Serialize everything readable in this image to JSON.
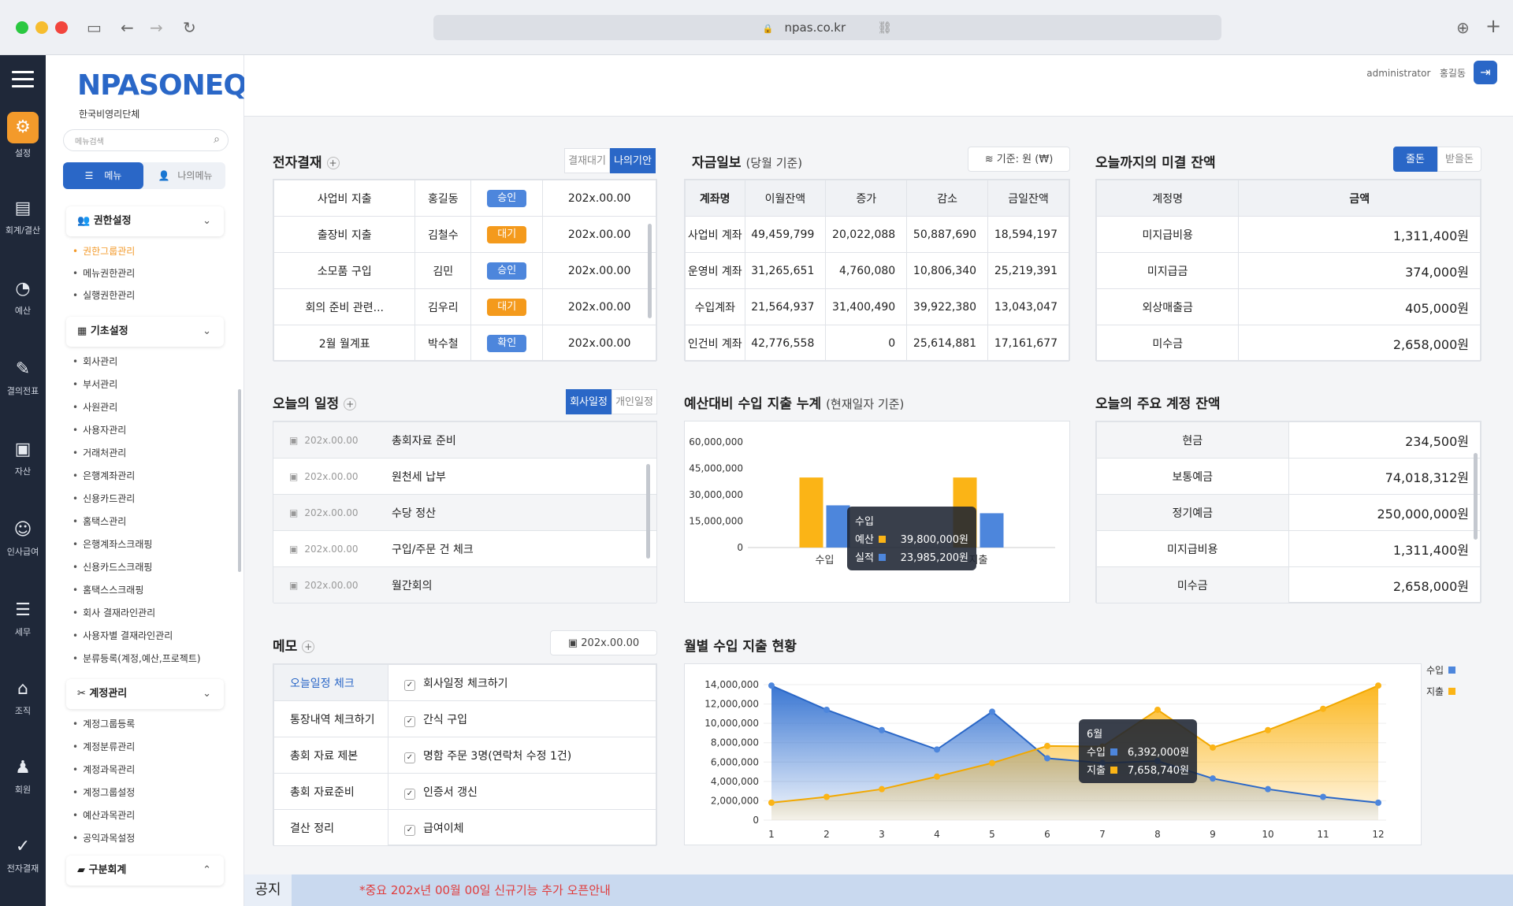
{
  "browser": {
    "url": "npas.co.kr"
  },
  "colors": {
    "accent": "#2a67c7",
    "orange": "#f49a1c",
    "income": "#4d86dc",
    "expense": "#fbb416",
    "notice": "#e03c3c"
  },
  "rail": [
    {
      "label": "설정",
      "icon": "gear-icon"
    },
    {
      "label": "회계/결산",
      "icon": "ledger-icon"
    },
    {
      "label": "예산",
      "icon": "pie-icon"
    },
    {
      "label": "결의전표",
      "icon": "voucher-icon"
    },
    {
      "label": "자산",
      "icon": "asset-icon"
    },
    {
      "label": "인사급여",
      "icon": "person-salary-icon"
    },
    {
      "label": "세무",
      "icon": "tax-icon"
    },
    {
      "label": "조직",
      "icon": "org-icon"
    },
    {
      "label": "회원",
      "icon": "members-icon"
    },
    {
      "label": "전자결재",
      "icon": "approval-icon"
    }
  ],
  "sidebar": {
    "logo": "NPASONEQ",
    "org": "한국비영리단체",
    "search_placeholder": "메뉴검색",
    "tab_menu": "메뉴",
    "tab_my": "나의메뉴",
    "group1": {
      "label": "권한설정",
      "items": [
        "권한그룹관리",
        "메뉴권한관리",
        "실행권한관리"
      ]
    },
    "group2": {
      "label": "기초설정",
      "items": [
        "회사관리",
        "부서관리",
        "사원관리",
        "사용자관리",
        "거래처관리",
        "은행계좌관리",
        "신용카드관리",
        "홈택스관리",
        "은행계좌스크래핑",
        "신용카드스크래핑",
        "홈택스스크래핑",
        "회사 결재라인관리",
        "사용자별 결재라인관리",
        "분류등록(계정,예산,프로젝트)"
      ]
    },
    "group3": {
      "label": "계정관리",
      "items": [
        "계정그룹등록",
        "계정분류관리",
        "계정과목관리",
        "계정그룹설정",
        "예산과목관리",
        "공익과목설정"
      ]
    },
    "group4": {
      "label": "구분회계"
    }
  },
  "header": {
    "user": "administrator",
    "name": "홍길동"
  },
  "approval": {
    "title": "전자결재",
    "tab_wait": "결재대기",
    "tab_mine": "나의기안",
    "rows": [
      {
        "title": "사업비 지출",
        "user": "홍길동",
        "status": "승인",
        "date": "202x.00.00"
      },
      {
        "title": "출장비 지출",
        "user": "김철수",
        "status": "대기",
        "date": "202x.00.00"
      },
      {
        "title": "소모품 구입",
        "user": "김민",
        "status": "승인",
        "date": "202x.00.00"
      },
      {
        "title": "회의 준비 관련...",
        "user": "김우리",
        "status": "대기",
        "date": "202x.00.00"
      },
      {
        "title": "2월 월계표",
        "user": "박수철",
        "status": "확인",
        "date": "202x.00.00"
      }
    ]
  },
  "funds": {
    "title": "자금일보",
    "subtitle": "(당월 기준)",
    "basis": "기준: 원 (₩)",
    "headers": [
      "계좌명",
      "이월잔액",
      "증가",
      "감소",
      "금일잔액"
    ],
    "rows": [
      [
        "사업비 계좌",
        "49,459,799",
        "20,022,088",
        "50,887,690",
        "18,594,197"
      ],
      [
        "운영비 계좌",
        "31,265,651",
        "4,760,080",
        "10,806,340",
        "25,219,391"
      ],
      [
        "수입계좌",
        "21,564,937",
        "31,400,490",
        "39,922,380",
        "13,043,047"
      ],
      [
        "인건비 계좌",
        "42,776,558",
        "0",
        "25,614,881",
        "17,161,677"
      ]
    ]
  },
  "unsettled": {
    "title": "오늘까지의 미결 잔액",
    "tab_give": "줄돈",
    "tab_recv": "받을돈",
    "headers": [
      "계정명",
      "금액"
    ],
    "rows": [
      [
        "미지급비용",
        "1,311,400원"
      ],
      [
        "미지급금",
        "374,000원"
      ],
      [
        "외상매출금",
        "405,000원"
      ],
      [
        "미수금",
        "2,658,000원"
      ]
    ]
  },
  "schedule": {
    "title": "오늘의 일정",
    "tab_company": "회사일정",
    "tab_personal": "개인일정",
    "rows": [
      {
        "date": "202x.00.00",
        "text": "총회자료 준비"
      },
      {
        "date": "202x.00.00",
        "text": "원천세 납부"
      },
      {
        "date": "202x.00.00",
        "text": "수당 정산"
      },
      {
        "date": "202x.00.00",
        "text": "구입/주문 건 체크"
      },
      {
        "date": "202x.00.00",
        "text": "월간회의"
      }
    ]
  },
  "budget_chart_title": {
    "main": "예산대비 수입 지출 누계",
    "sub": "(현재일자 기준)"
  },
  "balances": {
    "title": "오늘의 주요 계정 잔액",
    "rows": [
      [
        "현금",
        "234,500원"
      ],
      [
        "보통예금",
        "74,018,312원"
      ],
      [
        "정기예금",
        "250,000,000원"
      ],
      [
        "미지급비용",
        "1,311,400원"
      ],
      [
        "미수금",
        "2,658,000원"
      ]
    ]
  },
  "memo": {
    "title": "메모",
    "date": "202x.00.00",
    "rows": [
      {
        "key": "오늘일정 체크",
        "value": "회사일정 체크하기"
      },
      {
        "key": "통장내역 체크하기",
        "value": "간식 구입"
      },
      {
        "key": "총회 자료 제본",
        "value": "명함 주문 3명(연락처 수정 1건)"
      },
      {
        "key": "총회 자료준비",
        "value": "인증서 갱신"
      },
      {
        "key": "결산 정리",
        "value": "급여이체"
      }
    ]
  },
  "monthly_title": "월별 수입 지출 현황",
  "notice": {
    "label": "공지",
    "text": "*중요 202x년 00월 00일 신규기능 추가 오픈안내"
  },
  "chart_data": [
    {
      "type": "bar",
      "categories": [
        "수입",
        "지출"
      ],
      "series": [
        {
          "name": "예산",
          "values": [
            39800000,
            39800000
          ]
        },
        {
          "name": "실적",
          "values": [
            23985200,
            19500000
          ]
        }
      ],
      "yticks": [
        "60,000,000",
        "45,000,000",
        "30,000,000",
        "15,000,000",
        "0"
      ],
      "ylim": [
        0,
        60000000
      ],
      "tooltip": {
        "title": "수입",
        "rows": [
          [
            "예산",
            "39,800,000원"
          ],
          [
            "실적",
            "23,985,200원"
          ]
        ]
      }
    },
    {
      "type": "area",
      "x": [
        1,
        2,
        3,
        4,
        5,
        6,
        7,
        8,
        9,
        10,
        11,
        12
      ],
      "series": [
        {
          "name": "수입",
          "values": [
            13900000,
            11400000,
            9300000,
            7300000,
            11200000,
            6392000,
            5900000,
            6100000,
            4300000,
            3200000,
            2400000,
            1800000
          ]
        },
        {
          "name": "지출",
          "values": [
            1800000,
            2400000,
            3200000,
            4500000,
            5900000,
            7658740,
            7600000,
            11400000,
            7500000,
            9300000,
            11500000,
            13900000
          ]
        }
      ],
      "yticks": [
        "14,000,000",
        "12,000,000",
        "10,000,000",
        "8,000,000",
        "6,000,000",
        "4,000,000",
        "2,000,000",
        "0"
      ],
      "ylim": [
        0,
        14000000
      ],
      "legend": [
        "수입",
        "지출"
      ],
      "legend_position": "top-right",
      "tooltip": {
        "title": "6월",
        "rows": [
          [
            "수입",
            "6,392,000원"
          ],
          [
            "지출",
            "7,658,740원"
          ]
        ]
      }
    }
  ]
}
